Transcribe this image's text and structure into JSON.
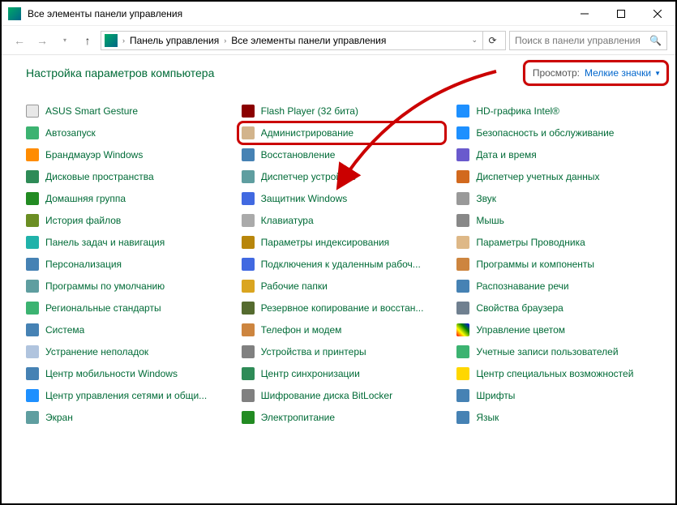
{
  "titlebar": {
    "text": "Все элементы панели управления"
  },
  "breadcrumb": {
    "root": "Панель управления",
    "current": "Все элементы панели управления"
  },
  "search": {
    "placeholder": "Поиск в панели управления"
  },
  "heading": "Настройка параметров компьютера",
  "view": {
    "label": "Просмотр:",
    "value": "Мелкие значки"
  },
  "items": [
    {
      "label": "ASUS Smart Gesture",
      "ic": "ic-asus"
    },
    {
      "label": "Flash Player (32 бита)",
      "ic": "ic-flash"
    },
    {
      "label": "HD-графика Intel®",
      "ic": "ic-hd"
    },
    {
      "label": "Автозапуск",
      "ic": "ic-auto"
    },
    {
      "label": "Администрирование",
      "ic": "ic-admin",
      "highlight": true
    },
    {
      "label": "Безопасность и обслуживание",
      "ic": "ic-sec"
    },
    {
      "label": "Брандмауэр Windows",
      "ic": "ic-fw"
    },
    {
      "label": "Восстановление",
      "ic": "ic-rec"
    },
    {
      "label": "Дата и время",
      "ic": "ic-dt"
    },
    {
      "label": "Дисковые пространства",
      "ic": "ic-disk"
    },
    {
      "label": "Диспетчер устройств",
      "ic": "ic-dev"
    },
    {
      "label": "Диспетчер учетных данных",
      "ic": "ic-cred"
    },
    {
      "label": "Домашняя группа",
      "ic": "ic-hg"
    },
    {
      "label": "Защитник Windows",
      "ic": "ic-def"
    },
    {
      "label": "Звук",
      "ic": "ic-snd"
    },
    {
      "label": "История файлов",
      "ic": "ic-fh"
    },
    {
      "label": "Клавиатура",
      "ic": "ic-kb"
    },
    {
      "label": "Мышь",
      "ic": "ic-ms"
    },
    {
      "label": "Панель задач и навигация",
      "ic": "ic-task"
    },
    {
      "label": "Параметры индексирования",
      "ic": "ic-idx"
    },
    {
      "label": "Параметры Проводника",
      "ic": "ic-exp"
    },
    {
      "label": "Персонализация",
      "ic": "ic-pers"
    },
    {
      "label": "Подключения к удаленным рабоч...",
      "ic": "ic-rdp"
    },
    {
      "label": "Программы и компоненты",
      "ic": "ic-prog"
    },
    {
      "label": "Программы по умолчанию",
      "ic": "ic-defp"
    },
    {
      "label": "Рабочие папки",
      "ic": "ic-wf"
    },
    {
      "label": "Распознавание речи",
      "ic": "ic-sr"
    },
    {
      "label": "Региональные стандарты",
      "ic": "ic-reg"
    },
    {
      "label": "Резервное копирование и восстан...",
      "ic": "ic-bak"
    },
    {
      "label": "Свойства браузера",
      "ic": "ic-brw"
    },
    {
      "label": "Система",
      "ic": "ic-sys"
    },
    {
      "label": "Телефон и модем",
      "ic": "ic-tel"
    },
    {
      "label": "Управление цветом",
      "ic": "ic-clr"
    },
    {
      "label": "Устранение неполадок",
      "ic": "ic-trb"
    },
    {
      "label": "Устройства и принтеры",
      "ic": "ic-prn"
    },
    {
      "label": "Учетные записи пользователей",
      "ic": "ic-usr"
    },
    {
      "label": "Центр мобильности Windows",
      "ic": "ic-mob"
    },
    {
      "label": "Центр синхронизации",
      "ic": "ic-sync"
    },
    {
      "label": "Центр специальных возможностей",
      "ic": "ic-ease"
    },
    {
      "label": "Центр управления сетями и общи...",
      "ic": "ic-net"
    },
    {
      "label": "Шифрование диска BitLocker",
      "ic": "ic-bit"
    },
    {
      "label": "Шрифты",
      "ic": "ic-font"
    },
    {
      "label": "Экран",
      "ic": "ic-scr"
    },
    {
      "label": "Электропитание",
      "ic": "ic-pwr"
    },
    {
      "label": "Язык",
      "ic": "ic-lang"
    }
  ]
}
